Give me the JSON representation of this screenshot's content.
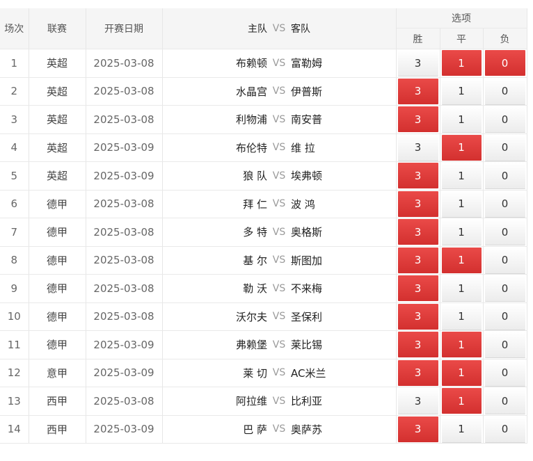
{
  "header": {
    "round": "场次",
    "league": "联赛",
    "date": "开赛日期",
    "home": "主队",
    "vs": "VS",
    "away": "客队",
    "options": "选项",
    "win": "胜",
    "draw": "平",
    "loss": "负"
  },
  "colors": {
    "selected": "#dc3b3a",
    "header_bg": "#f5f5f5"
  },
  "rows": [
    {
      "no": "1",
      "league": "英超",
      "date": "2025-03-08",
      "home": "布赖顿",
      "away": "富勒姆",
      "win": "3",
      "draw": "1",
      "loss": "0",
      "sel": [
        false,
        true,
        true
      ]
    },
    {
      "no": "2",
      "league": "英超",
      "date": "2025-03-08",
      "home": "水晶宫",
      "away": "伊普斯",
      "win": "3",
      "draw": "1",
      "loss": "0",
      "sel": [
        true,
        false,
        false
      ]
    },
    {
      "no": "3",
      "league": "英超",
      "date": "2025-03-08",
      "home": "利物浦",
      "away": "南安普",
      "win": "3",
      "draw": "1",
      "loss": "0",
      "sel": [
        true,
        false,
        false
      ]
    },
    {
      "no": "4",
      "league": "英超",
      "date": "2025-03-09",
      "home": "布伦特",
      "away": "维 拉",
      "win": "3",
      "draw": "1",
      "loss": "0",
      "sel": [
        false,
        true,
        false
      ]
    },
    {
      "no": "5",
      "league": "英超",
      "date": "2025-03-09",
      "home": "狼 队",
      "away": "埃弗顿",
      "win": "3",
      "draw": "1",
      "loss": "0",
      "sel": [
        true,
        false,
        false
      ]
    },
    {
      "no": "6",
      "league": "德甲",
      "date": "2025-03-08",
      "home": "拜 仁",
      "away": "波 鸿",
      "win": "3",
      "draw": "1",
      "loss": "0",
      "sel": [
        true,
        false,
        false
      ]
    },
    {
      "no": "7",
      "league": "德甲",
      "date": "2025-03-08",
      "home": "多 特",
      "away": "奥格斯",
      "win": "3",
      "draw": "1",
      "loss": "0",
      "sel": [
        true,
        false,
        false
      ]
    },
    {
      "no": "8",
      "league": "德甲",
      "date": "2025-03-08",
      "home": "基 尔",
      "away": "斯图加",
      "win": "3",
      "draw": "1",
      "loss": "0",
      "sel": [
        true,
        true,
        false
      ]
    },
    {
      "no": "9",
      "league": "德甲",
      "date": "2025-03-08",
      "home": "勒 沃",
      "away": "不来梅",
      "win": "3",
      "draw": "1",
      "loss": "0",
      "sel": [
        true,
        false,
        false
      ]
    },
    {
      "no": "10",
      "league": "德甲",
      "date": "2025-03-08",
      "home": "沃尔夫",
      "away": "圣保利",
      "win": "3",
      "draw": "1",
      "loss": "0",
      "sel": [
        true,
        false,
        false
      ]
    },
    {
      "no": "11",
      "league": "德甲",
      "date": "2025-03-09",
      "home": "弗赖堡",
      "away": "莱比锡",
      "win": "3",
      "draw": "1",
      "loss": "0",
      "sel": [
        true,
        true,
        false
      ]
    },
    {
      "no": "12",
      "league": "意甲",
      "date": "2025-03-09",
      "home": "莱 切",
      "away": "AC米兰",
      "win": "3",
      "draw": "1",
      "loss": "0",
      "sel": [
        true,
        true,
        false
      ]
    },
    {
      "no": "13",
      "league": "西甲",
      "date": "2025-03-08",
      "home": "阿拉维",
      "away": "比利亚",
      "win": "3",
      "draw": "1",
      "loss": "0",
      "sel": [
        false,
        true,
        false
      ]
    },
    {
      "no": "14",
      "league": "西甲",
      "date": "2025-03-09",
      "home": "巴 萨",
      "away": "奥萨苏",
      "win": "3",
      "draw": "1",
      "loss": "0",
      "sel": [
        true,
        false,
        false
      ]
    }
  ]
}
